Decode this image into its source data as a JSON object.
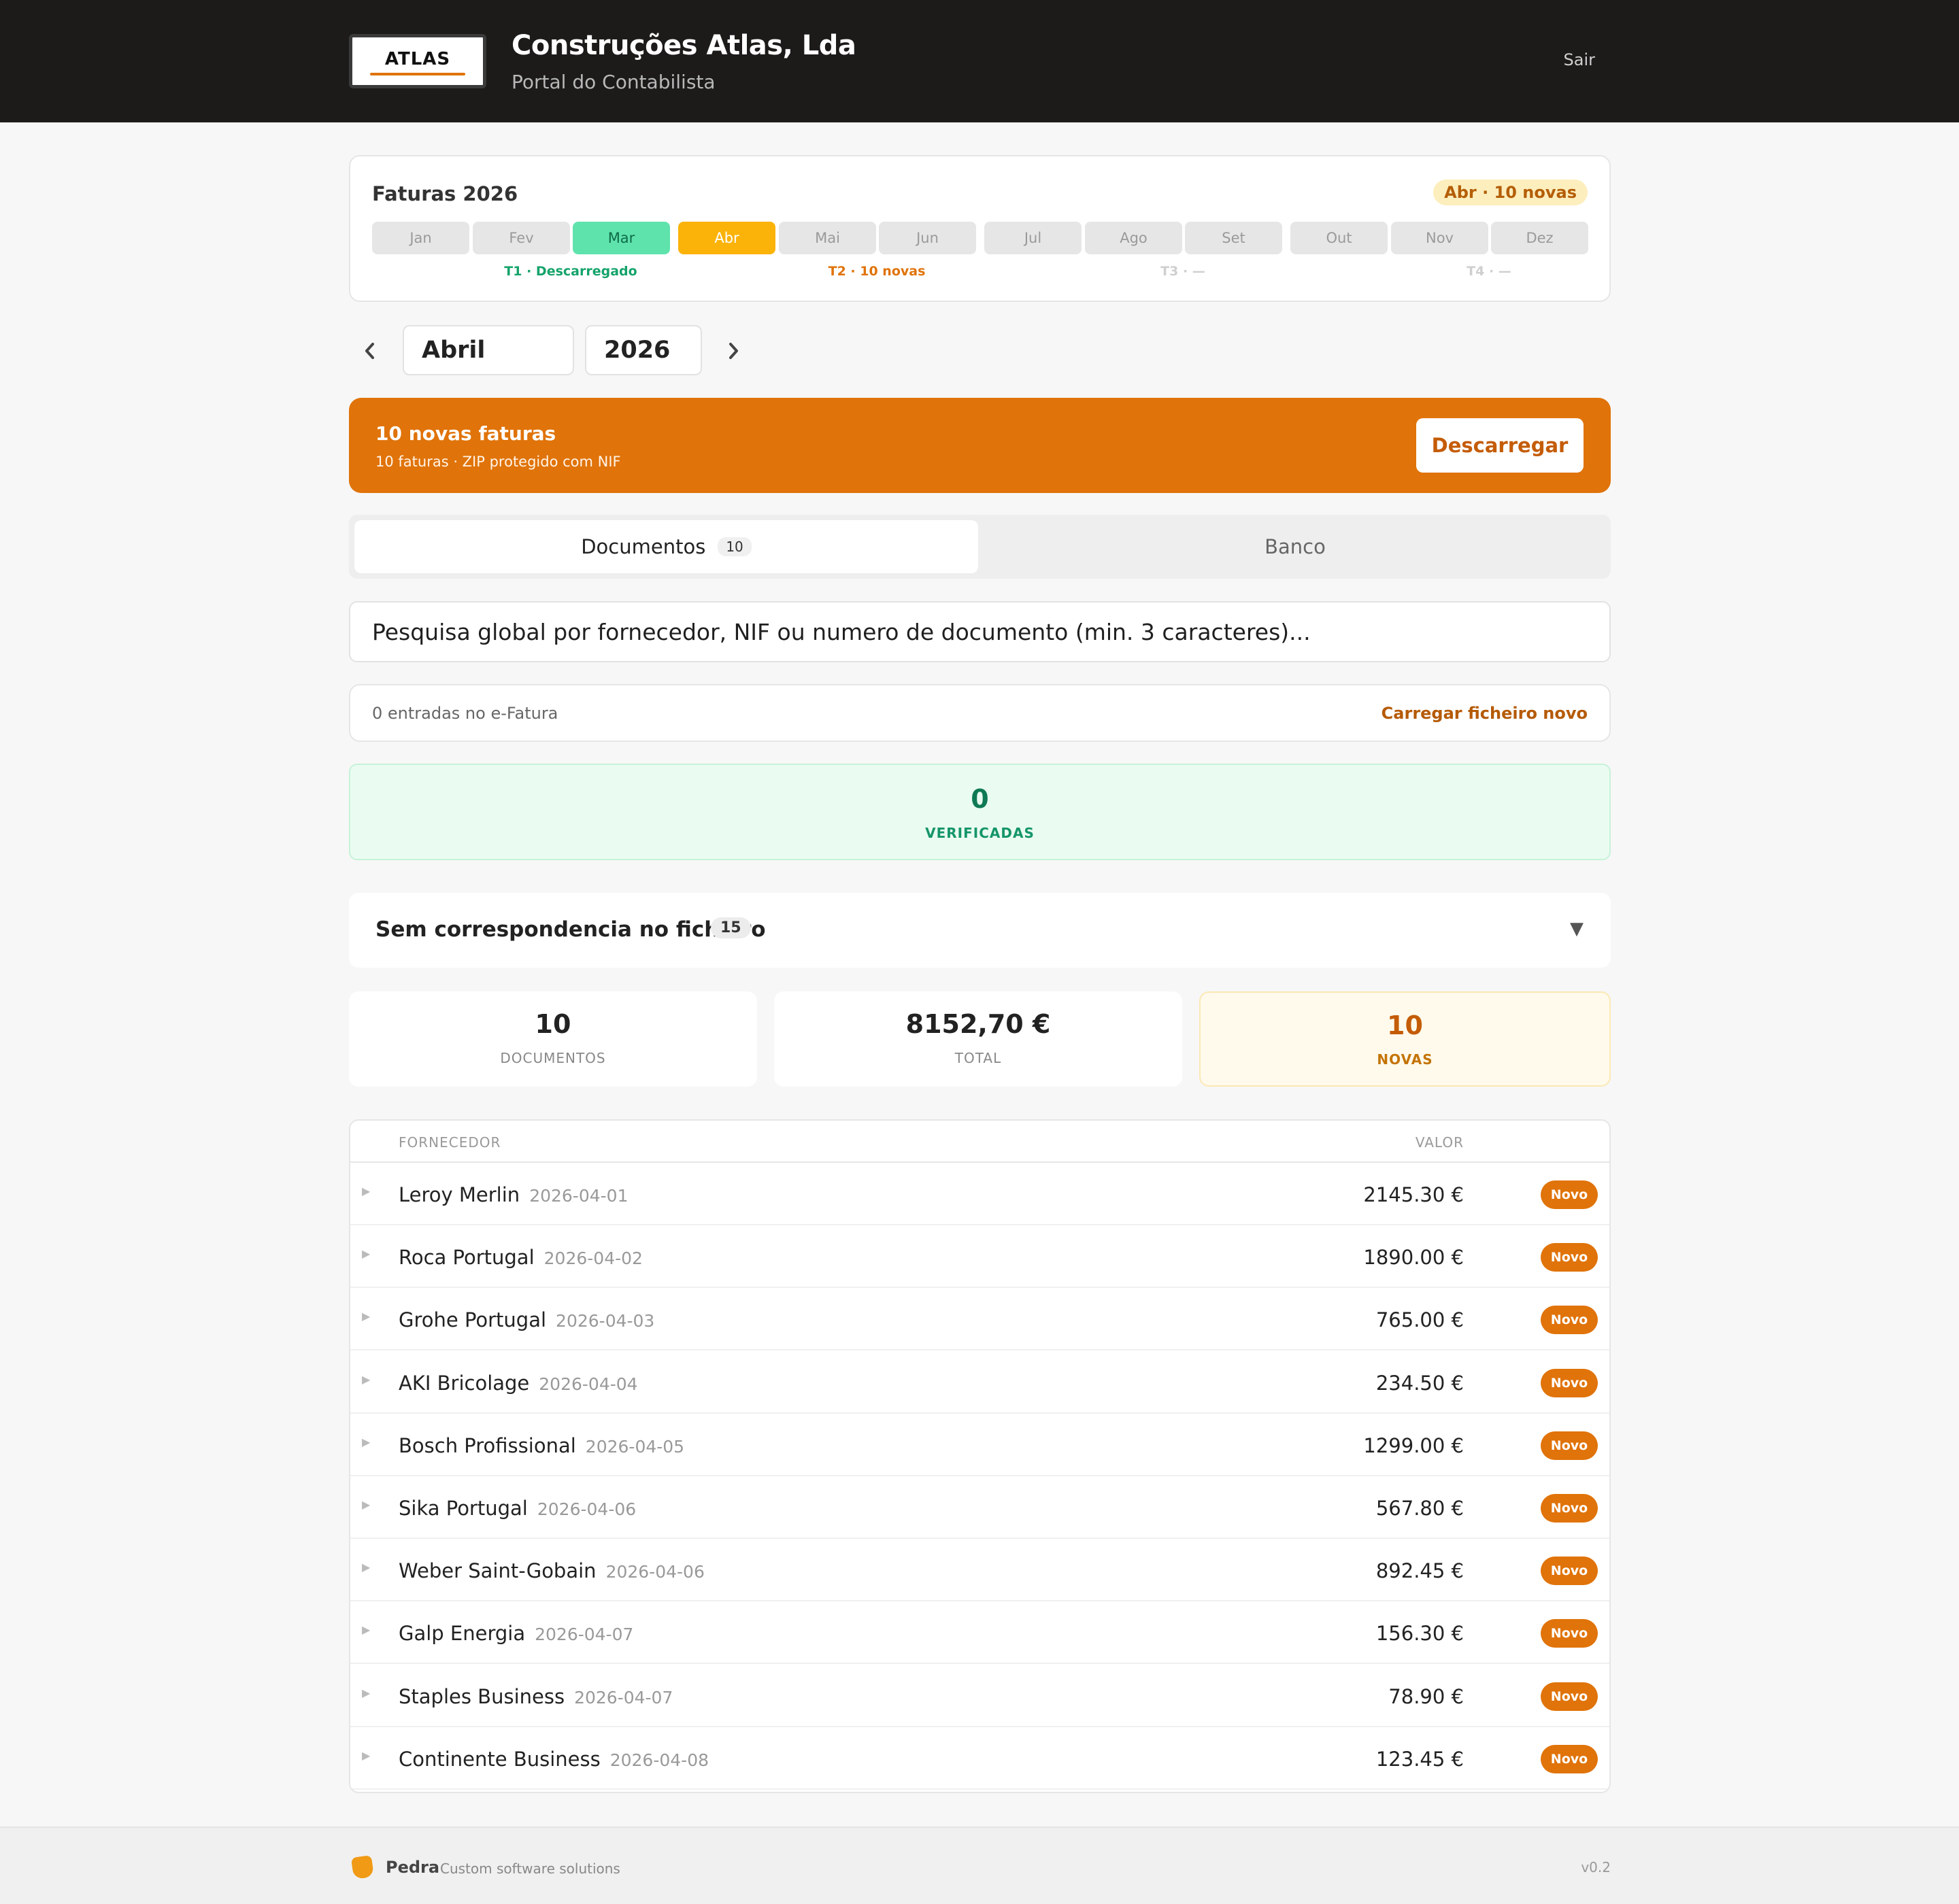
{
  "header": {
    "logo_text": "ATLAS",
    "company": "Construções Atlas, Lda",
    "subtitle": "Portal do Contabilista",
    "logout": "Sair"
  },
  "calendar": {
    "title": "Faturas 2026",
    "badge": "Abr · 10 novas",
    "months": [
      {
        "label": "Jan",
        "state": "default"
      },
      {
        "label": "Fev",
        "state": "default"
      },
      {
        "label": "Mar",
        "state": "done"
      },
      {
        "label": "Abr",
        "state": "active"
      },
      {
        "label": "Mai",
        "state": "default"
      },
      {
        "label": "Jun",
        "state": "default"
      },
      {
        "label": "Jul",
        "state": "default"
      },
      {
        "label": "Ago",
        "state": "default"
      },
      {
        "label": "Set",
        "state": "default"
      },
      {
        "label": "Out",
        "state": "default"
      },
      {
        "label": "Nov",
        "state": "default"
      },
      {
        "label": "Dez",
        "state": "default"
      }
    ],
    "quarters": [
      {
        "label": "T1 · Descarregado",
        "color": "#14a36a"
      },
      {
        "label": "T2 · 10 novas",
        "color": "#e07309"
      },
      {
        "label": "T3 · —",
        "color": "#cfcfcf"
      },
      {
        "label": "T4 · —",
        "color": "#cfcfcf"
      }
    ]
  },
  "period": {
    "prev_icon": "chevron-left-icon",
    "next_icon": "chevron-right-icon",
    "month": "Abril",
    "year": "2026"
  },
  "banner": {
    "title": "10 novas faturas",
    "subtitle": "10 faturas · ZIP protegido com NIF",
    "button": "Descarregar"
  },
  "tabs": {
    "documents": "Documentos",
    "documents_count": "10",
    "bank": "Banco"
  },
  "search": {
    "placeholder": "Pesquisa global por fornecedor, NIF ou numero de documento (min. 3 caracteres)..."
  },
  "efatura": {
    "text": "0 entradas no e-Fatura",
    "link": "Carregar ficheiro novo"
  },
  "verified": {
    "count": "0",
    "label": "VERIFICADAS"
  },
  "no_match": {
    "title": "Sem correspondencia no ficheiro",
    "count": "15",
    "caret": "▼"
  },
  "stats": {
    "documents": {
      "value": "10",
      "label": "DOCUMENTOS"
    },
    "total": {
      "value": "8152,70 €",
      "label": "TOTAL"
    },
    "new": {
      "value": "10",
      "label": "NOVAS"
    }
  },
  "table": {
    "col_supplier": "FORNECEDOR",
    "col_value": "VALOR",
    "rows": [
      {
        "name": "Leroy Merlin",
        "date": "2026-04-01",
        "value": "2145.30 €",
        "badge": "Novo"
      },
      {
        "name": "Roca Portugal",
        "date": "2026-04-02",
        "value": "1890.00 €",
        "badge": "Novo"
      },
      {
        "name": "Grohe Portugal",
        "date": "2026-04-03",
        "value": "765.00 €",
        "badge": "Novo"
      },
      {
        "name": "AKI Bricolage",
        "date": "2026-04-04",
        "value": "234.50 €",
        "badge": "Novo"
      },
      {
        "name": "Bosch Profissional",
        "date": "2026-04-05",
        "value": "1299.00 €",
        "badge": "Novo"
      },
      {
        "name": "Sika Portugal",
        "date": "2026-04-06",
        "value": "567.80 €",
        "badge": "Novo"
      },
      {
        "name": "Weber Saint-Gobain",
        "date": "2026-04-06",
        "value": "892.45 €",
        "badge": "Novo"
      },
      {
        "name": "Galp Energia",
        "date": "2026-04-07",
        "value": "156.30 €",
        "badge": "Novo"
      },
      {
        "name": "Staples Business",
        "date": "2026-04-07",
        "value": "78.90 €",
        "badge": "Novo"
      },
      {
        "name": "Continente Business",
        "date": "2026-04-08",
        "value": "123.45 €",
        "badge": "Novo"
      }
    ]
  },
  "footer": {
    "brand": "Pedra",
    "tagline": "Custom software solutions",
    "version": "v0.2"
  },
  "colors": {
    "accent": "#e07309",
    "header_bg": "#1c1b19",
    "success": "#0f7a55",
    "month_done": "#5fe3ad",
    "month_active": "#fbb30a"
  }
}
